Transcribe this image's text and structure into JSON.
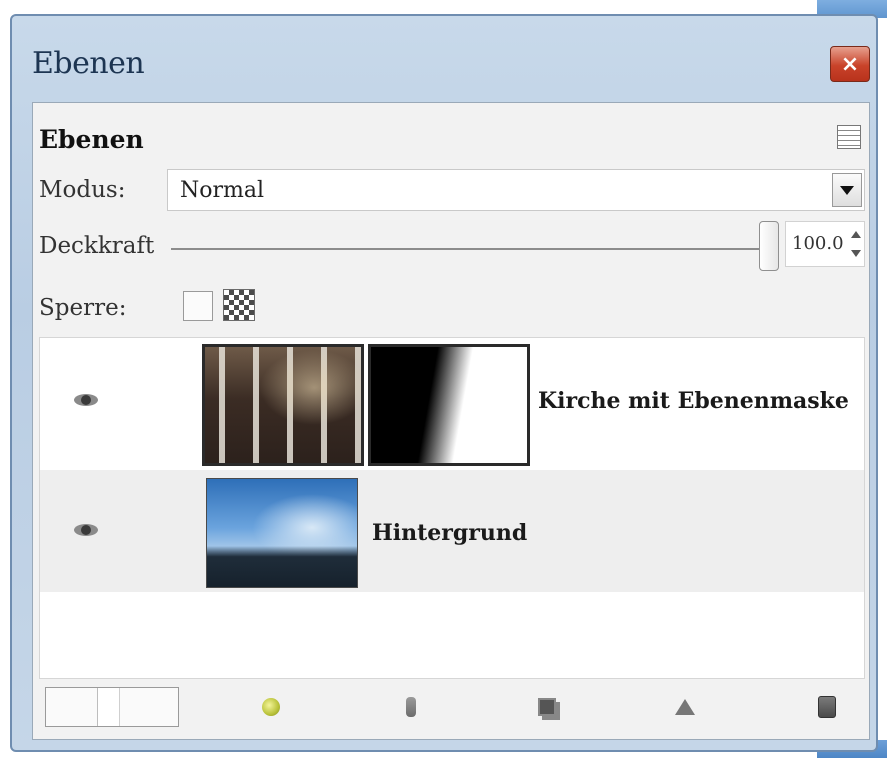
{
  "window": {
    "title": "Ebenen",
    "close_label": "×"
  },
  "panel": {
    "header": "Ebenen",
    "mode_label": "Modus:",
    "mode_value": "Normal",
    "opacity_label": "Deckkraft",
    "opacity_value": "100.0",
    "opacity_fraction": 1.0,
    "lock_label": "Sperre:"
  },
  "layers": [
    {
      "name": "Kirche mit Ebenenmaske",
      "visible": true,
      "has_mask": true
    },
    {
      "name": "Hintergrund",
      "visible": true,
      "has_mask": false
    }
  ],
  "toolbar": {
    "icons": [
      "new-layer-icon",
      "raise-layer-icon",
      "duplicate-layer-icon",
      "anchor-layer-icon",
      "delete-layer-icon"
    ]
  },
  "colors": {
    "close_button": "#c9432a",
    "window_frame": "#c8d9ea"
  }
}
